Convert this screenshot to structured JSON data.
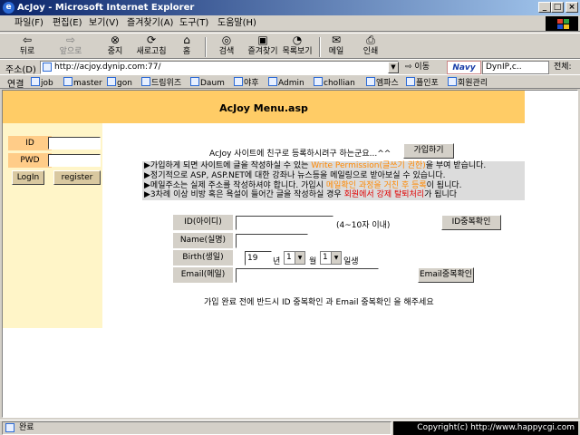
{
  "window": {
    "title": "AcJoy - Microsoft Internet Explorer",
    "min": "_",
    "max": "□",
    "close": "×"
  },
  "menu": [
    "파일(F)",
    "편집(E)",
    "보기(V)",
    "즐겨찾기(A)",
    "도구(T)",
    "도움말(H)"
  ],
  "toolbar": {
    "back": "뒤로",
    "forward": "앞으로",
    "stop": "중지",
    "refresh": "새로고침",
    "home": "홈",
    "search": "검색",
    "favorites": "즐겨찾기",
    "history": "목록보기",
    "mail": "메일",
    "print": "인쇄"
  },
  "address": {
    "label": "주소(D)",
    "url": "http://acjoy.dynip.com:77/",
    "go": "이동",
    "navy": "Navy",
    "search_text": "DynIP,c..",
    "search_all": "전체:"
  },
  "links": {
    "label": "연결",
    "items": [
      "job",
      "master",
      "gon",
      "드림위즈",
      "Daum",
      "야후",
      "Admin",
      "chollian",
      "엠파스",
      "플인포",
      "회원관리"
    ]
  },
  "page": {
    "title": "AcJoy Menu.asp",
    "login": {
      "id_label": "ID",
      "pwd_label": "PWD",
      "id_value": "",
      "pwd_value": "",
      "login_btn": "LogIn",
      "register_btn": "register"
    },
    "intro": "AcJoy 사이트에 친구로 등록하시려구 하는군요...^^",
    "join_btn": "가입하기",
    "notice": [
      {
        "prefix": "▶가입하게 되면 사이트에 글을 작성하실 수 있는 ",
        "hl": "Write Permission(글쓰기 권한)",
        "suffix": "을 부여 받습니다."
      },
      {
        "prefix": "▶정기적으로 ASP, ASP.NET에 대한 강좌나 뉴스등을 메일링으로 받아보실 수 있습니다.",
        "hl": "",
        "suffix": ""
      },
      {
        "prefix": "▶메일주소는 실제 주소를 작성하셔야 합니다. 가입시 ",
        "hl": "메일확인 과정을 거친 후 등록",
        "suffix": "이 됩니다."
      },
      {
        "prefix": "▶3차례 이상 비방 혹은 욕설이 들어간 글을 작성하실 경우 ",
        "hl": "회원에서 강제 탈퇴처리",
        "suffix": "가 됩니다"
      }
    ],
    "form": {
      "id_label": "ID(아이디)",
      "id_hint": "(4~10자 이내)",
      "id_check_btn": "ID중복확인",
      "name_label": "Name(실명)",
      "birth_label": "Birth(생일)",
      "year_value": "19",
      "year_unit": "년",
      "month_value": "1",
      "month_unit": "월",
      "day_value": "1",
      "day_unit": "일생",
      "email_label": "Email(메일)",
      "email_check_btn": "Email중복확인",
      "footer_note": "가입 완료 전에 반드시  ID 중복확인  과  Email 중복확인  을 해주세요"
    }
  },
  "status": {
    "text": "완료",
    "copyright": "Copyright(c) http://www.happycgi.com"
  },
  "colors": {
    "header": "#ffcc66",
    "side_panel": "#fff5c8",
    "label_bg": "#ffcc88",
    "notice_bg": "#dcdcdc",
    "highlight_orange": "#ff8800",
    "highlight_red": "#e00000"
  }
}
